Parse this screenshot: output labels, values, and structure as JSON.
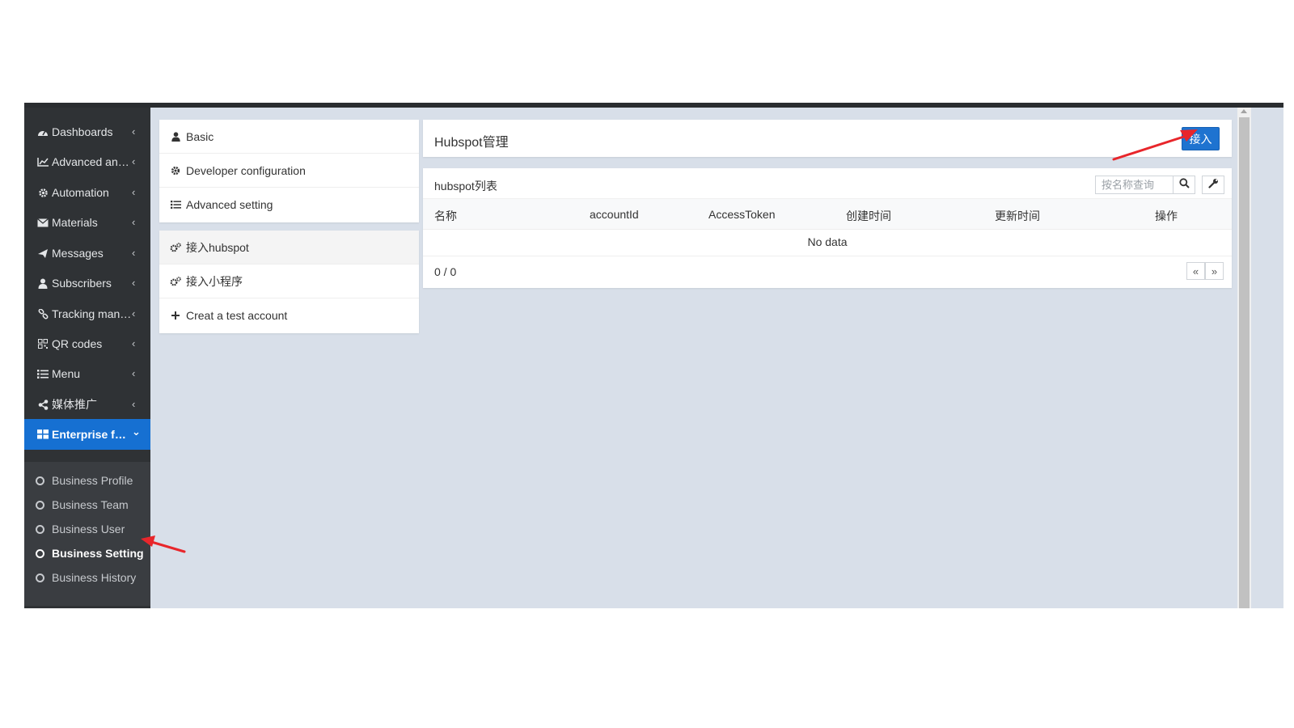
{
  "sidebar": {
    "items": [
      {
        "label": "Dashboards",
        "icon": "dashboard-icon"
      },
      {
        "label": "Advanced analytics",
        "icon": "line-chart-icon"
      },
      {
        "label": "Automation",
        "icon": "gear-icon"
      },
      {
        "label": "Materials",
        "icon": "envelope-icon"
      },
      {
        "label": "Messages",
        "icon": "paper-plane-icon"
      },
      {
        "label": "Subscribers",
        "icon": "user-icon"
      },
      {
        "label": "Tracking management",
        "icon": "link-icon"
      },
      {
        "label": "QR codes",
        "icon": "qrcode-icon"
      },
      {
        "label": "Menu",
        "icon": "list-icon"
      },
      {
        "label": "媒体推广",
        "icon": "share-icon"
      },
      {
        "label": "Enterprise functions",
        "icon": "grid-icon"
      }
    ],
    "chevron_collapsed": "‹",
    "chevron_expanded": "⌄",
    "submenu": [
      {
        "label": "Business Profile"
      },
      {
        "label": "Business Team"
      },
      {
        "label": "Business User"
      },
      {
        "label": "Business Setting"
      },
      {
        "label": "Business History"
      }
    ]
  },
  "settings_panel": {
    "top": [
      {
        "label": "Basic",
        "icon": "user-icon"
      },
      {
        "label": "Developer configuration",
        "icon": "gear-icon"
      },
      {
        "label": "Advanced setting",
        "icon": "list-icon"
      }
    ],
    "bottom": [
      {
        "label": "接入hubspot",
        "icon": "gears-icon"
      },
      {
        "label": "接入小程序",
        "icon": "gears-icon"
      },
      {
        "label": "Creat a test account",
        "icon": "plus-icon"
      }
    ]
  },
  "main": {
    "header_title": "Hubspot管理",
    "connect_button": "接入",
    "list_title": "hubspot列表",
    "search_placeholder": "按名称查询",
    "columns": [
      "名称",
      "accountId",
      "AccessToken",
      "创建时间",
      "更新时间",
      "操作"
    ],
    "empty_text": "No data",
    "page_info": "0 / 0",
    "prev_label": "«",
    "next_label": "»"
  },
  "colors": {
    "sidebar_bg": "#2f3235",
    "active_blue": "#1670d2",
    "content_bg": "#d8dfe9",
    "annotation_red": "#e8262b"
  }
}
